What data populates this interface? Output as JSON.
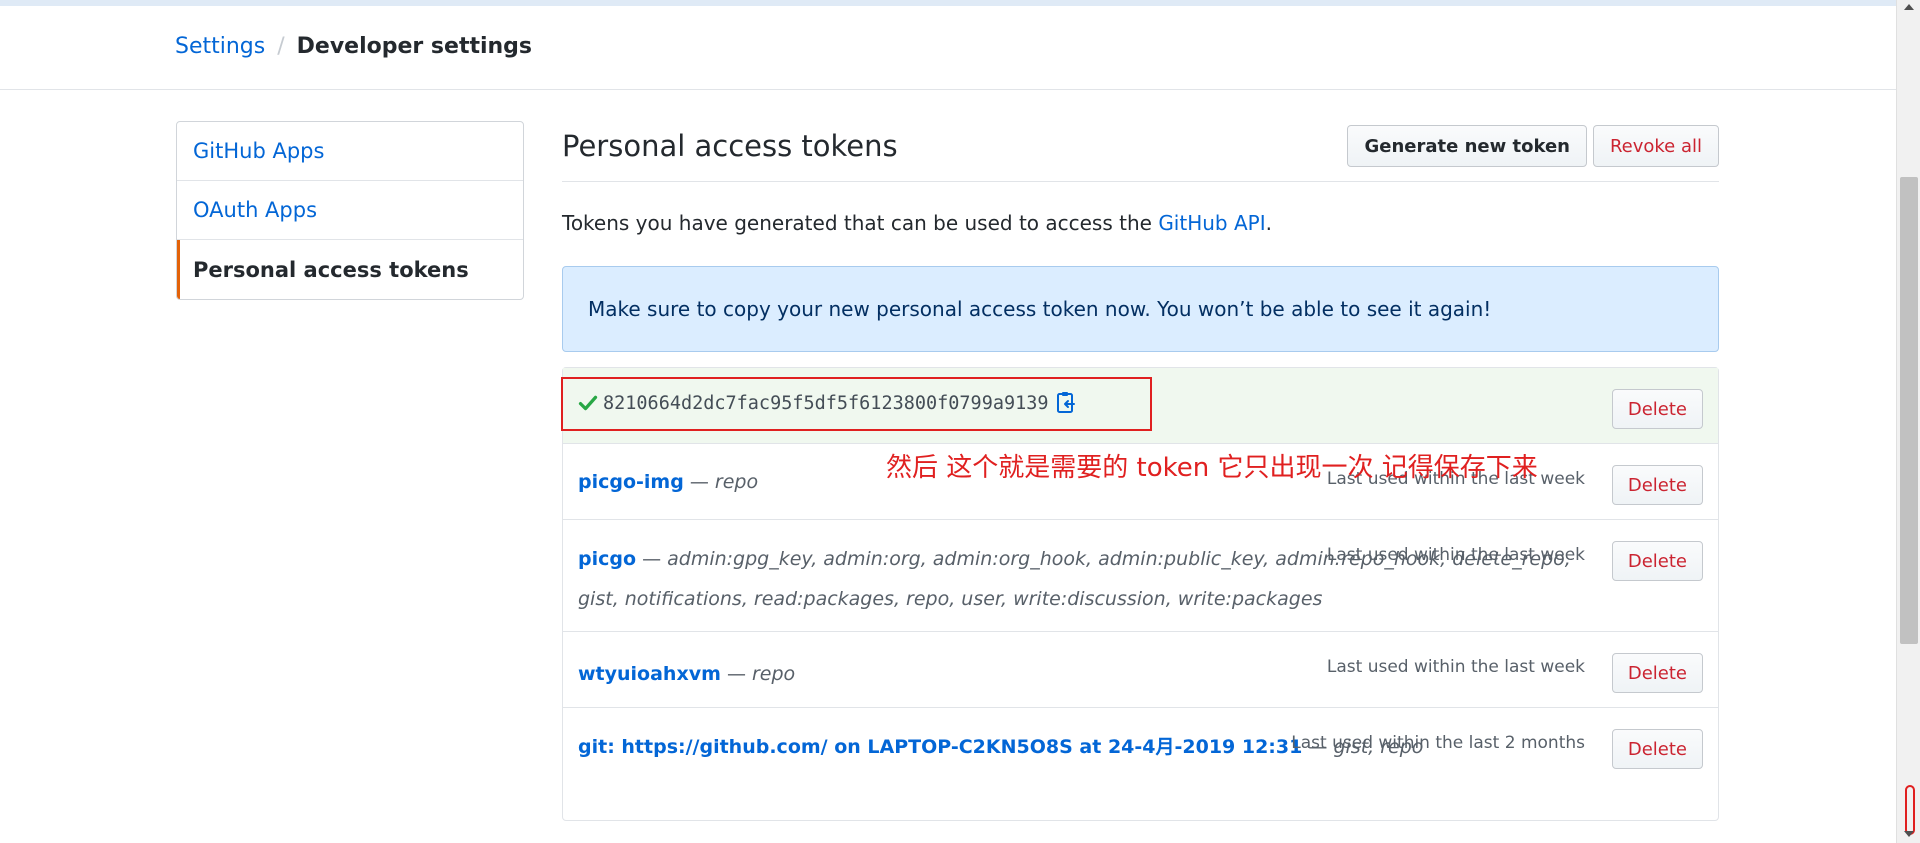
{
  "breadcrumb": {
    "settings": "Settings",
    "separator": "/",
    "current": "Developer settings"
  },
  "sidebar": {
    "items": [
      {
        "label": "GitHub Apps"
      },
      {
        "label": "OAuth Apps"
      },
      {
        "label": "Personal access tokens",
        "selected": true
      }
    ]
  },
  "main": {
    "title": "Personal access tokens",
    "generate_button": "Generate new token",
    "revoke_button": "Revoke all",
    "intro_text": "Tokens you have generated that can be used to access the ",
    "intro_link": "GitHub API",
    "intro_end": ".",
    "flash_message": "Make sure to copy your new personal access token now. You won’t be able to see it again!"
  },
  "new_token": {
    "value": "8210664d2dc7fac95f5df5f6123800f0799a9139",
    "check_icon": "check-icon",
    "copy_icon": "clipboard-copy-icon",
    "delete": "Delete"
  },
  "tokens": [
    {
      "name": "picgo-img",
      "dash": " — ",
      "scopes": "repo",
      "last_used": "Last used within the last week",
      "delete": "Delete"
    },
    {
      "name": "picgo",
      "dash": " — ",
      "scopes": "admin:gpg_key, admin:org, admin:org_hook, admin:public_key, admin:repo_hook, delete_repo, gist, notifications, read:packages, repo, user, write:discussion, write:packages",
      "last_used": "Last used within the last week",
      "delete": "Delete"
    },
    {
      "name": "wtyuioahxvm",
      "dash": " — ",
      "scopes": "repo",
      "last_used": "Last used within the last week",
      "delete": "Delete"
    },
    {
      "name": "git: https://github.com/ on LAPTOP-C2KN5O8S at 24-4月-2019 12:31",
      "dash": " — ",
      "scopes": "gist, repo",
      "last_used": "Last used within the last 2 months",
      "delete": "Delete"
    }
  ],
  "annotation": "然后 这个就是需要的 token 它只出现一次 记得保存下来",
  "colors": {
    "accent": "#0366d6",
    "danger": "#cb2431",
    "annotation": "#e02020",
    "selected_bar": "#e36209"
  }
}
